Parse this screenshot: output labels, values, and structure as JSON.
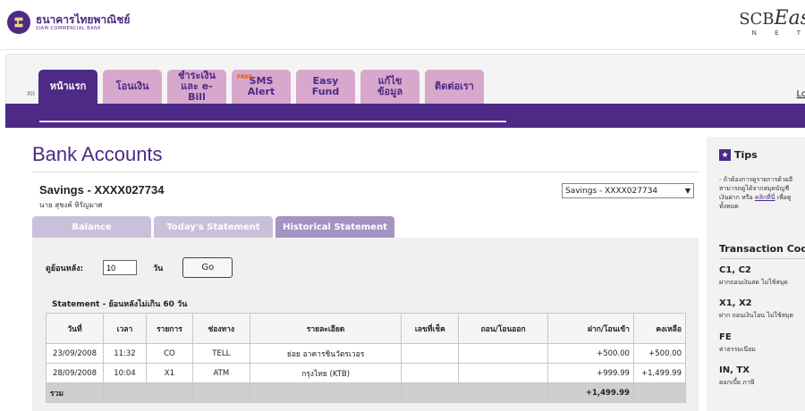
{
  "header": {
    "bank_name_th": "ธนาคารไทยพาณิชย์",
    "bank_name_en": "SIAM COMMERCIAL BANK",
    "scb": "SCB",
    "easy": "Eas",
    "net": "N E T"
  },
  "nav": {
    "small_label": "XII",
    "tabs": [
      {
        "label": "หน้าแรก",
        "active": true
      },
      {
        "label": "โอนเงิน"
      },
      {
        "label": "ชำระเงิน",
        "label2": "และ e-Bill"
      },
      {
        "badge": "FREE",
        "label": "SMS Alert"
      },
      {
        "label": "Easy Fund"
      },
      {
        "label": "แก้ไขข้อมูล"
      },
      {
        "label": "ติดต่อเรา"
      }
    ],
    "logout_label": "Lo"
  },
  "page": {
    "title": "Bank Accounts",
    "account_title": "Savings - XXXX027734",
    "owner": "นาย สุชงค์ หิรัญมาศ",
    "account_select": "Savings - XXXX027734"
  },
  "sub_tabs": [
    {
      "label": "Balance"
    },
    {
      "label": "Today's Statement"
    },
    {
      "label": "Historical Statement",
      "active": true
    }
  ],
  "search": {
    "label": "ดูย้อนหลัง:",
    "days_value": "10",
    "unit": "วัน",
    "go_label": "Go"
  },
  "statement": {
    "caption": "Statement - ย้อนหลังไม่เกิน 60 วัน",
    "columns": [
      "วันที่",
      "เวลา",
      "รายการ",
      "ช่องทาง",
      "รายละเอียด",
      "เลขที่เช็ค",
      "ถอน/โอนออก",
      "ฝาก/โอนเข้า",
      "คงเหลือ"
    ],
    "rows": [
      [
        "23/09/2008",
        "11:32",
        "CO",
        "TELL",
        "ย่อย อาคารชินวัตรเวอร",
        "",
        "",
        "+500.00",
        "+500.00"
      ],
      [
        "28/09/2008",
        "10:04",
        "X1",
        "ATM",
        "กรุงไทย (KTB)",
        "",
        "",
        "+999.99",
        "+1,499.99"
      ]
    ],
    "total_label": "รวม",
    "total_deposit": "+1,499.99"
  },
  "sidebar": {
    "tips_title": "Tips",
    "tips_lines": [
      "- ถ้าต้องการดูรายการด้วยอี",
      "สามารถดูได้จากสมุดบัญชี",
      "เงินฝาก หรือ",
      "ทั้งหมด"
    ],
    "tips_link": "คลิกที่นี่",
    "tips_after_link": " เพื่อดู",
    "codes_title": "Transaction Codes",
    "codes": [
      {
        "code": "C1, C2",
        "desc": "ฝากถอนเงินสด ไม่ใช้สมุด"
      },
      {
        "code": "X1, X2",
        "desc": "ฝาก ถอนเงินโอน ไม่ใช้สมุด"
      },
      {
        "code": "FE",
        "desc": "ค่าธรรมเนียม"
      },
      {
        "code": "IN, TX",
        "desc": "ดอกเบี้ย ภาษี"
      }
    ]
  },
  "colors": {
    "brand_purple": "#4c2a85",
    "tab_pink": "#d7a8cc",
    "subtab_inactive": "#c9c1d9",
    "subtab_active": "#a493c3"
  }
}
